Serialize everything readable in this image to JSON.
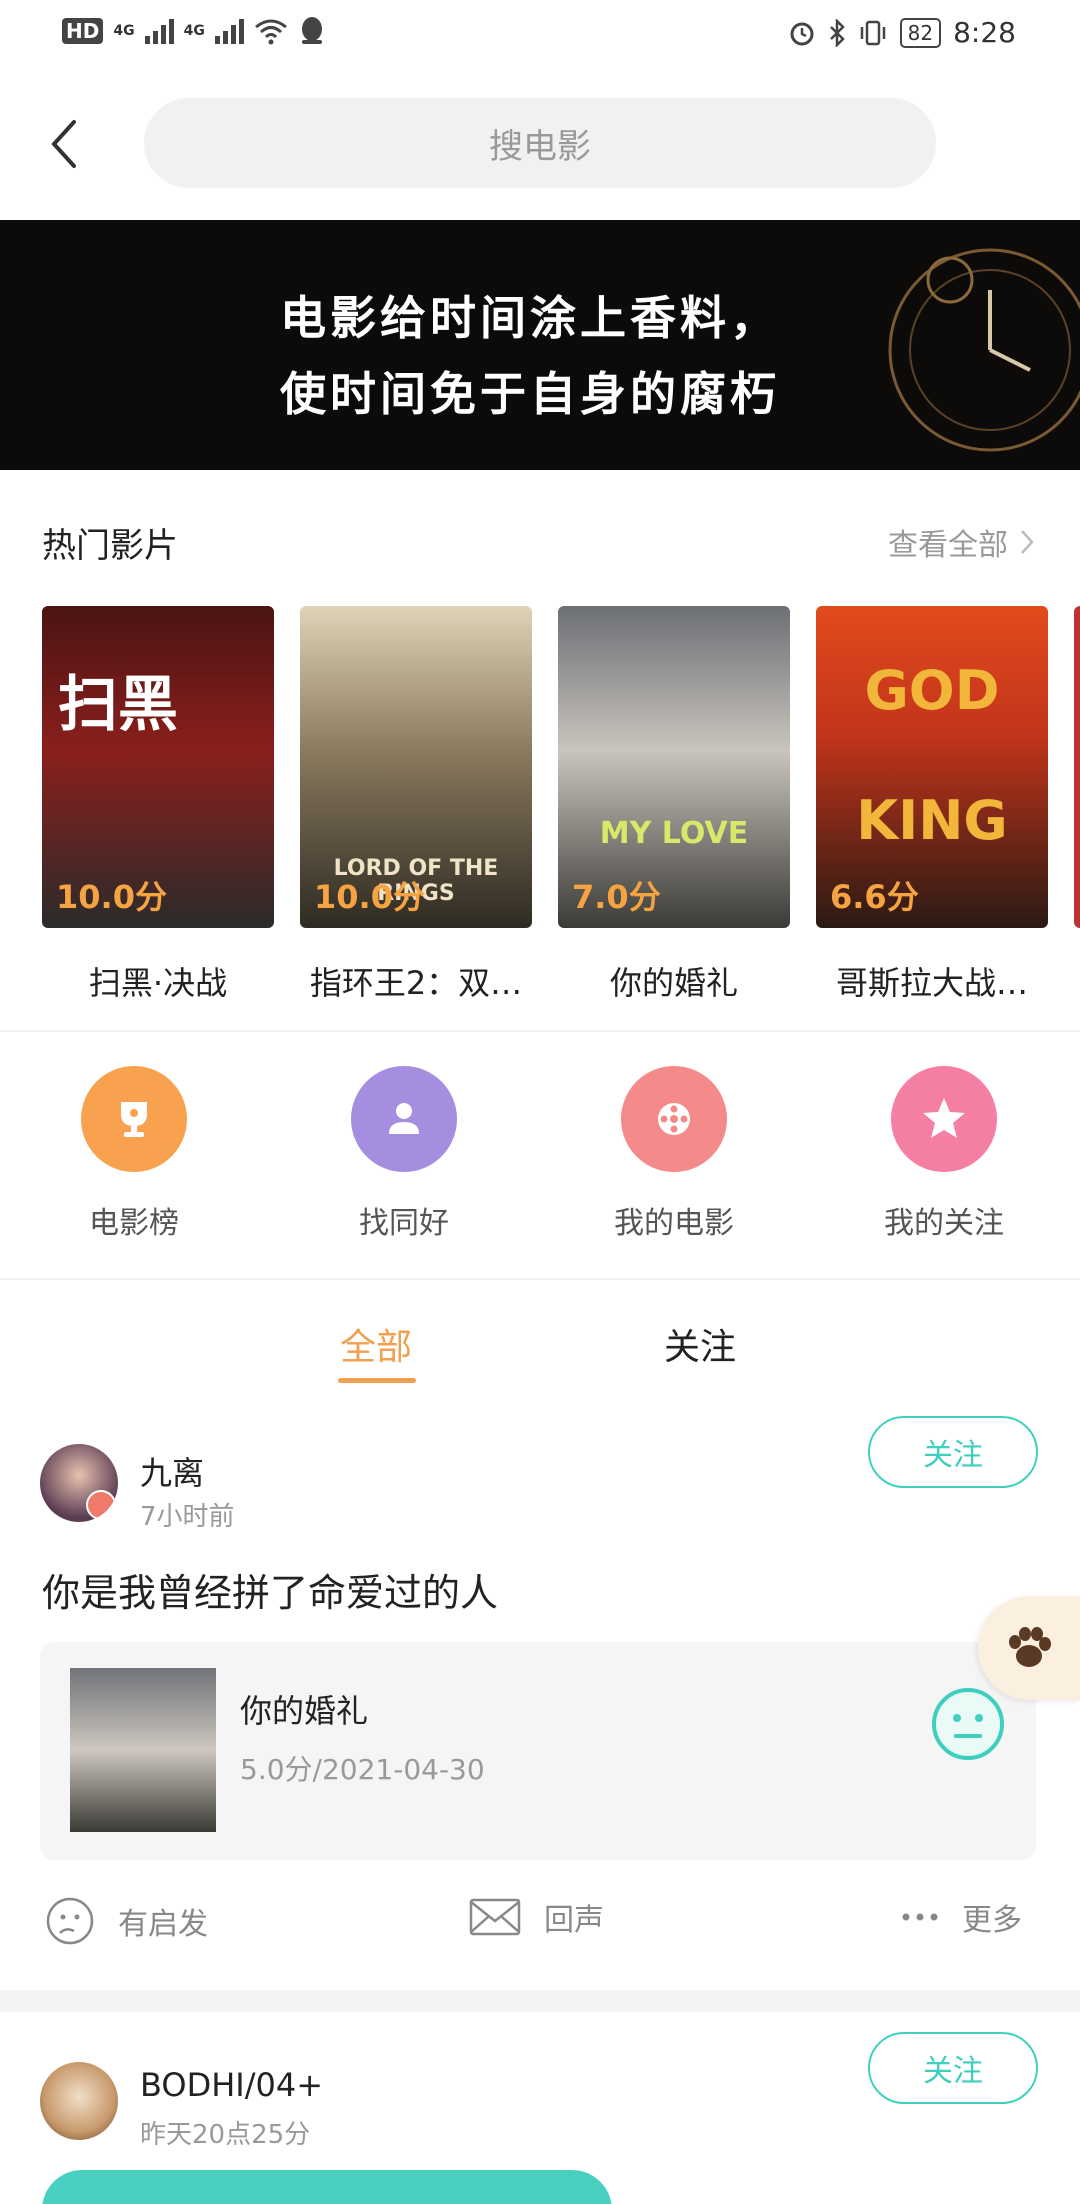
{
  "status_bar": {
    "time": "8:28",
    "battery": "82",
    "network1": "4G",
    "network2": "4G",
    "hd": "HD"
  },
  "search": {
    "placeholder": "搜电影"
  },
  "banner": {
    "line1": "电影给时间涂上香料，",
    "line2": "使时间免于自身的腐朽"
  },
  "hot": {
    "title": "热门影片",
    "see_all": "查看全部",
    "movies": [
      {
        "title": "扫黑·决战",
        "score": "10.0分",
        "poster_text": "扫黑"
      },
      {
        "title": "指环王2：双…",
        "score": "10.0分",
        "poster_text": "LORD OF THE RINGS"
      },
      {
        "title": "你的婚礼",
        "score": "7.0分",
        "poster_text": "MY LOVE"
      },
      {
        "title": "哥斯拉大战…",
        "score": "6.6分",
        "poster_text": "GOD KING"
      }
    ]
  },
  "quick": [
    {
      "label": "电影榜",
      "color": "#f8a24f",
      "icon": "trophy-icon"
    },
    {
      "label": "找同好",
      "color": "#a58ee0",
      "icon": "people-icon"
    },
    {
      "label": "我的电影",
      "color": "#f58a8a",
      "icon": "film-reel-icon"
    },
    {
      "label": "我的关注",
      "color": "#f57ea3",
      "icon": "star-icon"
    }
  ],
  "tabs": {
    "all": "全部",
    "follow": "关注"
  },
  "posts": [
    {
      "user": "九离",
      "time": "7小时前",
      "follow": "关注",
      "text": "你是我曾经拼了命爱过的人",
      "movie": {
        "title": "你的婚礼",
        "meta": "5.0分/2021-04-30"
      },
      "actions": {
        "inspire": "有启发",
        "echo": "回声",
        "more": "更多"
      }
    },
    {
      "user": "BODHI/04+",
      "time": "昨天20点25分",
      "follow": "关注"
    }
  ],
  "colors": {
    "accent": "#f2a04f",
    "teal": "#3fcfbf"
  }
}
